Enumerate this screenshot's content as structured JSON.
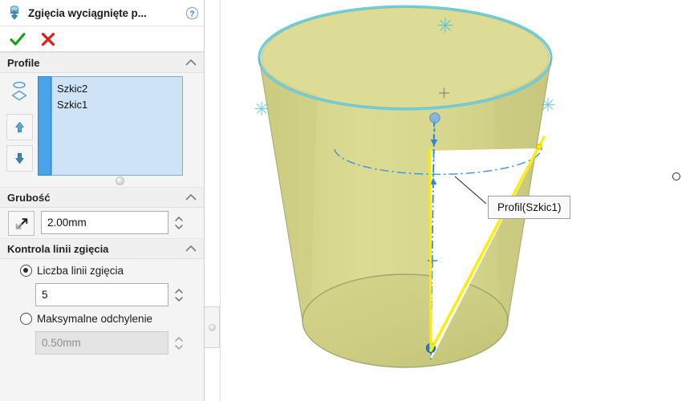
{
  "panel": {
    "title": "Zgięcia wyciągnięte p...",
    "title_icon": "lofted-bend-icon",
    "help_icon": "help-icon",
    "accept_label": "✔",
    "cancel_label": "✘",
    "groups": {
      "profile": {
        "title": "Profile",
        "icon": "profile-loops-icon",
        "move_up_label": "▲",
        "move_down_label": "▼",
        "items": [
          {
            "label": "Szkic2"
          },
          {
            "label": "Szkic1"
          }
        ]
      },
      "thickness": {
        "title": "Grubość",
        "reverse_icon": "reverse-direction-icon",
        "value": "2.00mm"
      },
      "bend_control": {
        "title": "Kontrola linii zgięcia",
        "option_count": {
          "label": "Liczba linii zgięcia",
          "selected": true,
          "value": "5"
        },
        "option_deviation": {
          "label": "Maksymalne odchylenie",
          "selected": false,
          "value": "0.50mm"
        }
      }
    }
  },
  "viewport": {
    "callout": {
      "text": "Profil(Szkic1)"
    },
    "colors": {
      "body_fill": "#d9d98f",
      "body_fill_light": "#e2e2a4",
      "rim_edge": "#5bc3d6",
      "sketch_yellow": "#ffee00",
      "centerline_blue": "#2f86d8",
      "silhouette": "#9aa870"
    }
  }
}
